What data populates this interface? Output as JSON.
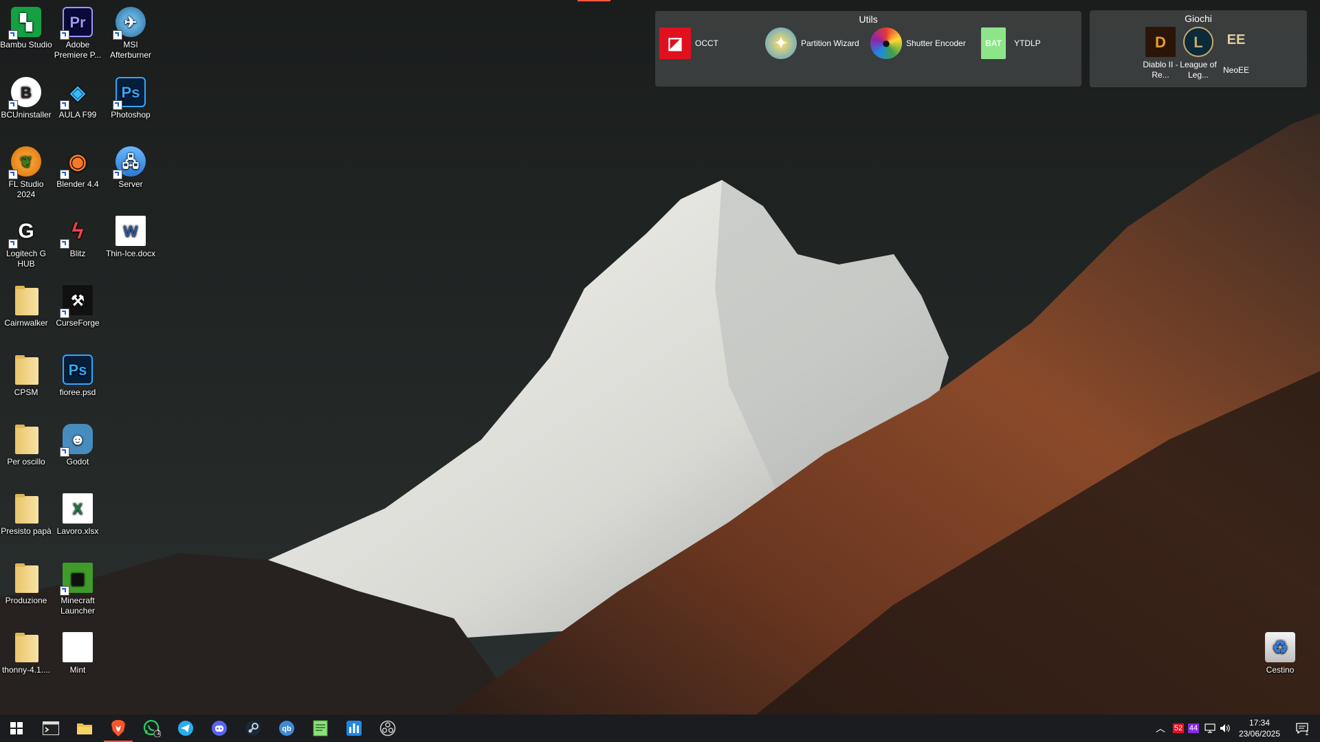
{
  "desktop": {
    "icons": [
      {
        "label": "Bambu Studio",
        "icon": "bambu-studio-icon"
      },
      {
        "label": "Adobe Premiere P...",
        "icon": "premiere-icon"
      },
      {
        "label": "MSI Afterburner",
        "icon": "afterburner-icon"
      },
      {
        "label": "BCUninstaller",
        "icon": "bcuninstaller-icon"
      },
      {
        "label": "AULA F99",
        "icon": "aula-icon"
      },
      {
        "label": "Photoshop",
        "icon": "photoshop-icon"
      },
      {
        "label": "FL Studio 2024",
        "icon": "fl-studio-icon"
      },
      {
        "label": "Blender 4.4",
        "icon": "blender-icon"
      },
      {
        "label": "Server",
        "icon": "server-icon"
      },
      {
        "label": "Logitech G HUB",
        "icon": "logitech-icon"
      },
      {
        "label": "Blitz",
        "icon": "blitz-icon"
      },
      {
        "label": "Thin-Ice.docx",
        "icon": "word-doc-icon"
      },
      {
        "label": "Cairnwalker",
        "icon": "folder-icon"
      },
      {
        "label": "CurseForge",
        "icon": "curseforge-icon"
      },
      {
        "label": "CPSM",
        "icon": "folder-icon"
      },
      {
        "label": "fioree.psd",
        "icon": "psd-file-icon"
      },
      {
        "label": "Per oscillo",
        "icon": "folder-icon"
      },
      {
        "label": "Godot",
        "icon": "godot-icon"
      },
      {
        "label": "Presisto papà",
        "icon": "folder-icon"
      },
      {
        "label": "Lavoro.xlsx",
        "icon": "excel-file-icon"
      },
      {
        "label": "Produzione",
        "icon": "folder-icon"
      },
      {
        "label": "Minecraft Launcher",
        "icon": "minecraft-icon"
      },
      {
        "label": "thonny-4.1....",
        "icon": "folder-icon"
      },
      {
        "label": "Mint",
        "icon": "blank-file-icon"
      }
    ],
    "recycle_bin": {
      "label": "Cestino",
      "icon": "recycle-bin-icon"
    }
  },
  "fences": {
    "utils": {
      "title": "Utils",
      "items": [
        {
          "label": "OCCT",
          "icon": "occt-icon"
        },
        {
          "label": "Partition Wizard",
          "icon": "partition-wizard-icon"
        },
        {
          "label": "Shutter Encoder",
          "icon": "shutter-encoder-icon"
        },
        {
          "label": "YTDLP",
          "icon": "bat-file-icon"
        }
      ]
    },
    "giochi": {
      "title": "Giochi",
      "items": [
        {
          "label": "Diablo II - Re...",
          "icon": "diablo-icon"
        },
        {
          "label": "League of Leg...",
          "icon": "league-icon"
        },
        {
          "label": "NeoEE",
          "icon": "neoee-icon"
        }
      ]
    }
  },
  "taskbar": {
    "apps": [
      {
        "name": "start-button",
        "icon": "windows-icon"
      },
      {
        "name": "terminal",
        "icon": "terminal-icon"
      },
      {
        "name": "file-explorer",
        "icon": "folder-icon"
      },
      {
        "name": "brave",
        "icon": "brave-icon",
        "active": true
      },
      {
        "name": "whatsapp",
        "icon": "whatsapp-icon",
        "badge": "1"
      },
      {
        "name": "telegram",
        "icon": "telegram-icon"
      },
      {
        "name": "discord",
        "icon": "discord-icon"
      },
      {
        "name": "steam",
        "icon": "steam-icon"
      },
      {
        "name": "qbittorrent",
        "icon": "qbittorrent-icon"
      },
      {
        "name": "notepad",
        "icon": "notepad-icon"
      },
      {
        "name": "task-manager-app",
        "icon": "chart-app-icon"
      },
      {
        "name": "obs",
        "icon": "obs-icon"
      }
    ],
    "tray": {
      "cpu_temp": "52",
      "gpu_temp": "44",
      "time": "17:34",
      "date": "23/06/2025",
      "notification_count": "1"
    },
    "colors": {
      "accent": "#ff5a3d",
      "cpu_badge": "#e81123",
      "gpu_badge": "#8a2be2"
    }
  }
}
